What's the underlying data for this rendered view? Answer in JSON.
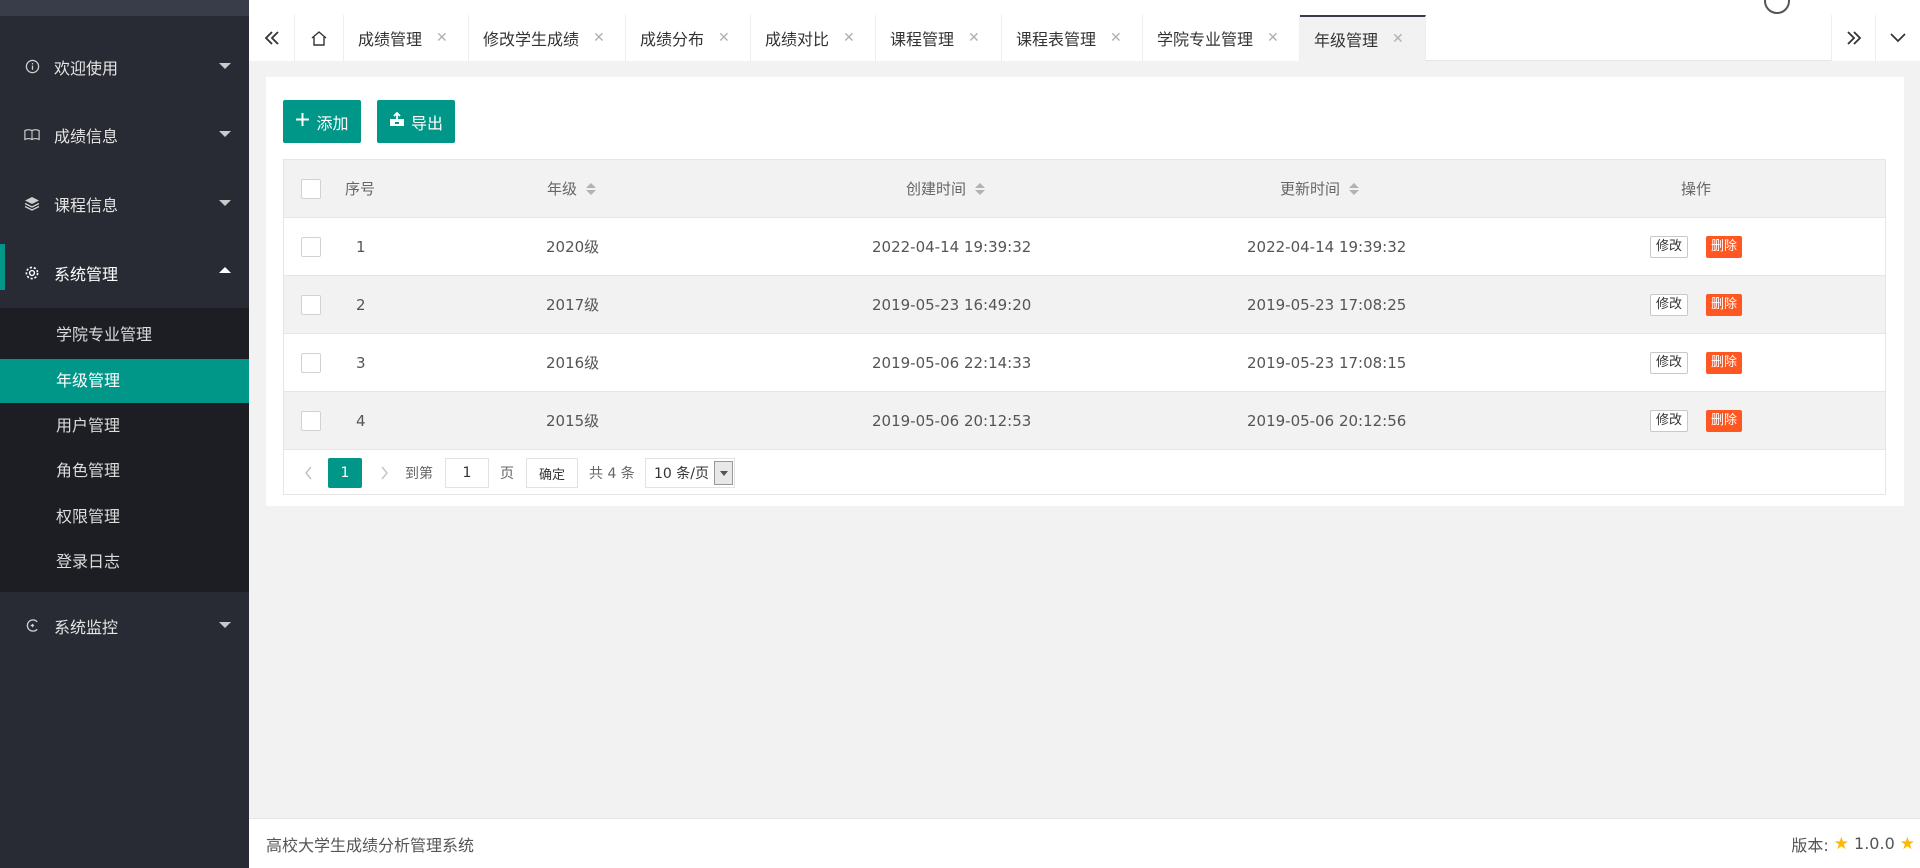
{
  "sidebar": {
    "items": [
      {
        "label": "欢迎使用",
        "icon": "info-circle-icon"
      },
      {
        "label": "成绩信息",
        "icon": "book-icon"
      },
      {
        "label": "课程信息",
        "icon": "layers-icon"
      },
      {
        "label": "系统管理",
        "icon": "gear-icon"
      },
      {
        "label": "系统监控",
        "icon": "monitor-icon"
      }
    ],
    "submenu": [
      "学院专业管理",
      "年级管理",
      "用户管理",
      "角色管理",
      "权限管理",
      "登录日志"
    ]
  },
  "tabs": [
    {
      "label": "成绩管理"
    },
    {
      "label": "修改学生成绩"
    },
    {
      "label": "成绩分布"
    },
    {
      "label": "成绩对比"
    },
    {
      "label": "课程管理"
    },
    {
      "label": "课程表管理"
    },
    {
      "label": "学院专业管理"
    },
    {
      "label": "年级管理"
    }
  ],
  "tab_close_glyph": "✕",
  "toolbar": {
    "add_label": "添加",
    "export_label": "导出",
    "add_icon": "plus-icon",
    "export_icon": "export-icon"
  },
  "table": {
    "headers": {
      "seq": "序号",
      "grade": "年级",
      "created": "创建时间",
      "updated": "更新时间",
      "ops": "操作"
    },
    "edit_label": "修改",
    "delete_label": "删除",
    "rows": [
      {
        "seq": "1",
        "grade": "2020级",
        "created": "2022-04-14 19:39:32",
        "updated": "2022-04-14 19:39:32"
      },
      {
        "seq": "2",
        "grade": "2017级",
        "created": "2019-05-23 16:49:20",
        "updated": "2019-05-23 17:08:25"
      },
      {
        "seq": "3",
        "grade": "2016级",
        "created": "2019-05-06 22:14:33",
        "updated": "2019-05-23 17:08:15"
      },
      {
        "seq": "4",
        "grade": "2015级",
        "created": "2019-05-06 20:12:53",
        "updated": "2019-05-06 20:12:56"
      }
    ]
  },
  "pager": {
    "current_page": "1",
    "goto_label": "到第",
    "goto_value": "1",
    "page_unit": "页",
    "confirm_label": "确定",
    "total_label": "共 4 条",
    "page_size": "10 条/页"
  },
  "footer": {
    "title": "高校大学生成绩分析管理系统",
    "version_label": "版本:",
    "version": "1.0.0"
  },
  "colors": {
    "primary": "#009688",
    "danger": "#ff5722",
    "sidebar_bg": "#282b33",
    "submenu_bg": "#1c1e23",
    "star": "#ffb800"
  }
}
